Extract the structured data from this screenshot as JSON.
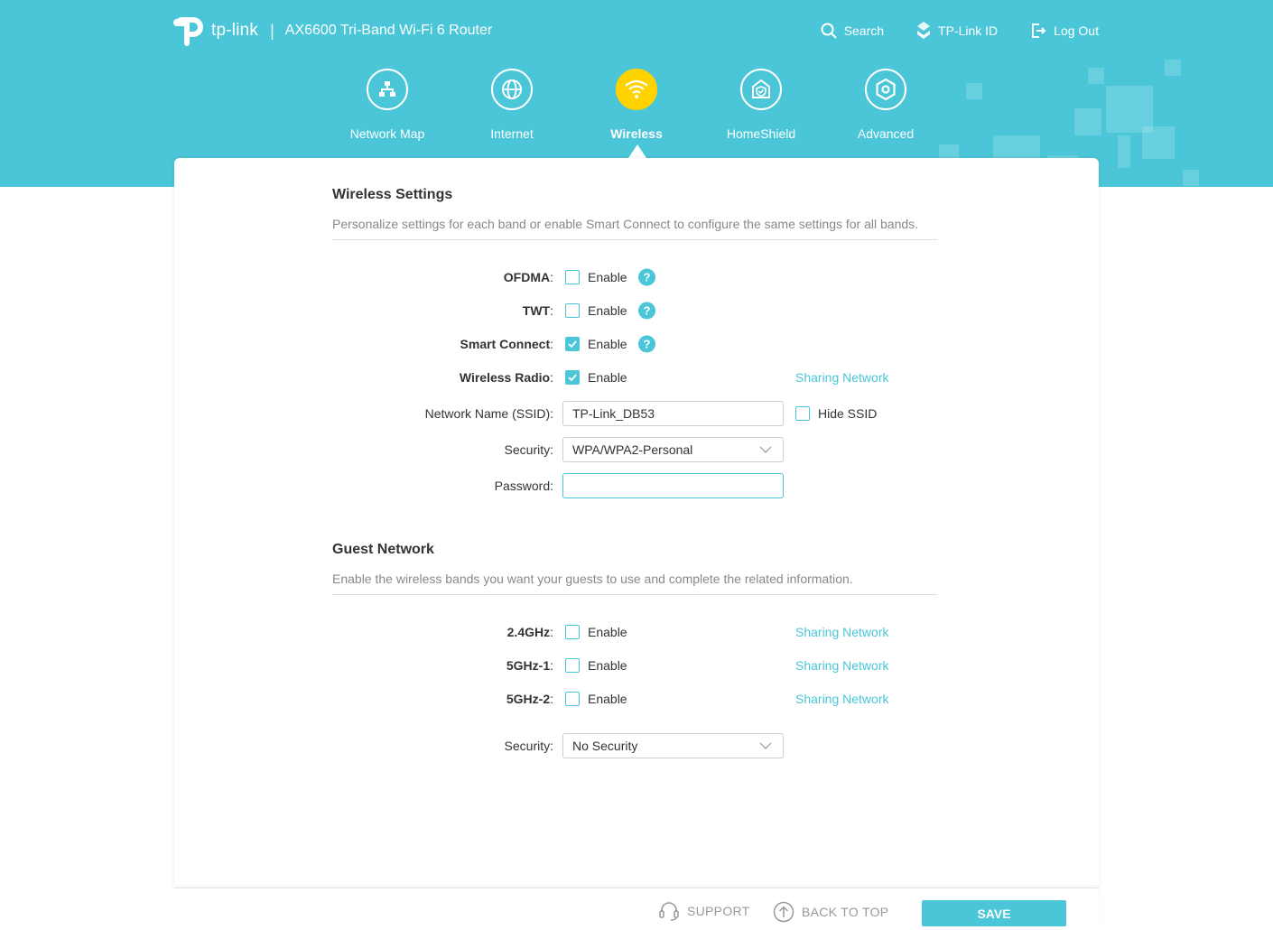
{
  "header": {
    "brand": "tp-link",
    "separator": "|",
    "product": "AX6600 Tri-Band Wi-Fi 6 Router",
    "links": {
      "search": "Search",
      "tplink_id": "TP-Link ID",
      "logout": "Log Out"
    }
  },
  "nav": {
    "active": "Wireless",
    "items": [
      {
        "label": "Network Map",
        "icon": "network-map-icon"
      },
      {
        "label": "Internet",
        "icon": "globe-icon"
      },
      {
        "label": "Wireless",
        "icon": "wifi-icon"
      },
      {
        "label": "HomeShield",
        "icon": "homeshield-icon"
      },
      {
        "label": "Advanced",
        "icon": "gear-icon"
      }
    ]
  },
  "wireless": {
    "title": "Wireless Settings",
    "description": "Personalize settings for each band or enable Smart Connect to configure the same settings for all bands.",
    "ofdma": {
      "label": "OFDMA",
      "option": "Enable",
      "checked": false
    },
    "twt": {
      "label": "TWT",
      "option": "Enable",
      "checked": false
    },
    "smart_connect": {
      "label": "Smart Connect",
      "option": "Enable",
      "checked": true
    },
    "wireless_radio": {
      "label": "Wireless Radio",
      "option": "Enable",
      "checked": true,
      "link": "Sharing Network"
    },
    "ssid": {
      "label": "Network Name (SSID):",
      "value": "TP-Link_DB53",
      "hide_label": "Hide SSID",
      "hide_checked": false
    },
    "security": {
      "label": "Security:",
      "value": "WPA/WPA2-Personal"
    },
    "password": {
      "label": "Password:",
      "value": ""
    },
    "help_glyph": "?"
  },
  "guest": {
    "title": "Guest Network",
    "description": "Enable the wireless bands you want your guests to use and complete the related information.",
    "bands": [
      {
        "label": "2.4GHz",
        "option": "Enable",
        "checked": false,
        "link": "Sharing Network"
      },
      {
        "label": "5GHz-1",
        "option": "Enable",
        "checked": false,
        "link": "Sharing Network"
      },
      {
        "label": "5GHz-2",
        "option": "Enable",
        "checked": false,
        "link": "Sharing Network"
      }
    ],
    "security": {
      "label": "Security:",
      "value": "No Security"
    }
  },
  "footer": {
    "support": "SUPPORT",
    "back_to_top": "BACK TO TOP",
    "save": "SAVE"
  },
  "colors": {
    "brand": "#4ac6d8",
    "active_nav": "#ffd200",
    "muted_text": "#888888"
  }
}
